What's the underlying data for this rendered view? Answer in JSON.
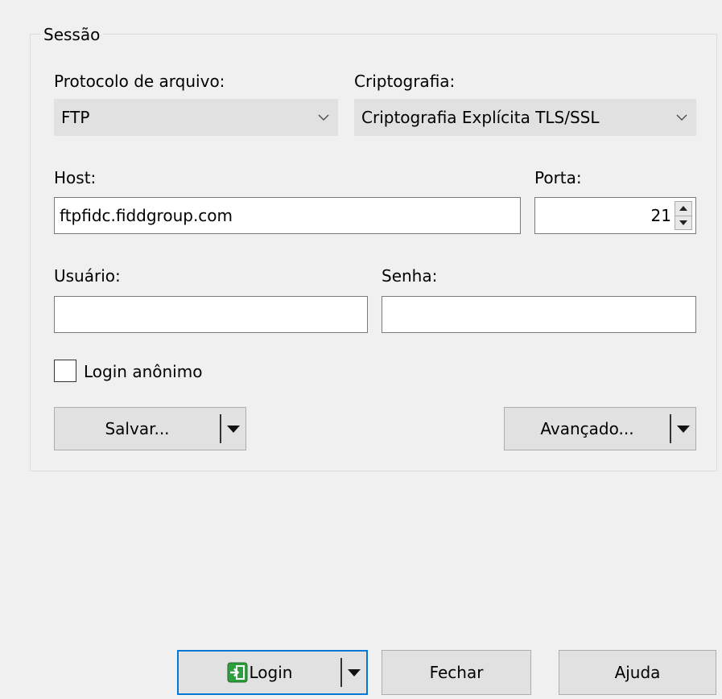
{
  "session": {
    "title": "Sessão",
    "protocol_label": "Protocolo de arquivo:",
    "protocol_value": "FTP",
    "encryption_label": "Criptografia:",
    "encryption_value": "Criptografia Explícita TLS/SSL",
    "host_label": "Host:",
    "host_value": "ftpfidc.fiddgroup.com",
    "port_label": "Porta:",
    "port_value": "21",
    "user_label": "Usuário:",
    "user_value": "",
    "password_label": "Senha:",
    "password_value": "",
    "anonymous_label": "Login anônimo",
    "anonymous_checked": false,
    "save_label": "Salvar...",
    "advanced_label": "Avançado..."
  },
  "footer": {
    "login_label": "Login",
    "close_label": "Fechar",
    "help_label": "Ajuda"
  },
  "colors": {
    "focus_border": "#0078d7",
    "login_icon": "#2e9e3e"
  },
  "icons": {
    "combo_arrow": "chevron-down-icon",
    "spin_up": "triangle-up-icon",
    "spin_down": "triangle-down-icon",
    "split_drop": "triangle-down-icon",
    "login": "login-icon"
  }
}
